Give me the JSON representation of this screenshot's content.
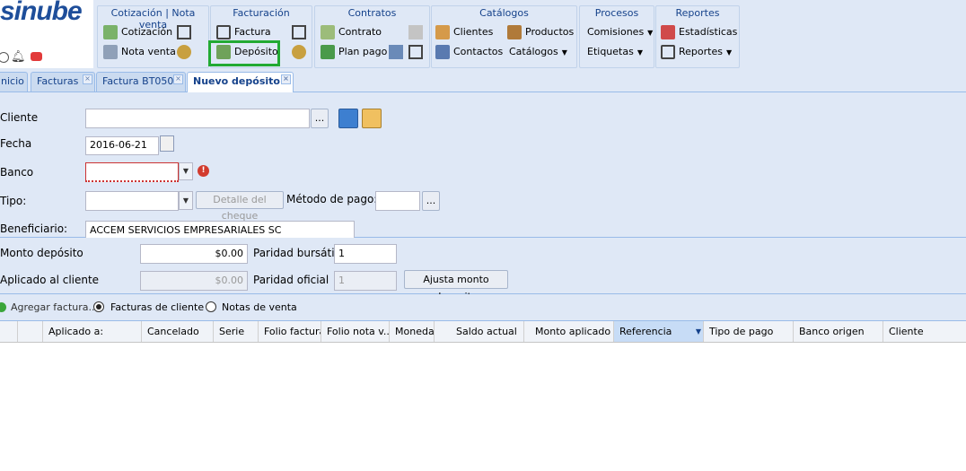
{
  "app": {
    "logo_text": "sinube"
  },
  "ribbon": {
    "groups": [
      {
        "title": "Cotización | Nota venta",
        "items": [
          "Cotización",
          "Nota venta"
        ]
      },
      {
        "title": "Facturación",
        "items": [
          "Factura",
          "Depósito"
        ]
      },
      {
        "title": "Contratos",
        "items": [
          "Contrato",
          "Plan pago"
        ]
      },
      {
        "title": "Catálogos",
        "items": [
          "Clientes",
          "Contactos",
          "Productos",
          "Catálogos"
        ]
      },
      {
        "title": "Procesos",
        "items": [
          "Comisiones",
          "Etiquetas"
        ]
      },
      {
        "title": "Reportes",
        "items": [
          "Estadísticas",
          "Reportes"
        ]
      }
    ],
    "highlight_color": "#22aa33"
  },
  "tabs": [
    {
      "label": "nicio"
    },
    {
      "label": "Facturas"
    },
    {
      "label": "Factura BT050"
    },
    {
      "label": "Nuevo depósito"
    }
  ],
  "form": {
    "cliente_label": "Cliente",
    "cliente_value": "",
    "fecha_label": "Fecha",
    "fecha_value": "2016-06-21",
    "banco_label": "Banco",
    "banco_value": "",
    "tipo_label": "Tipo:",
    "tipo_value": "",
    "detalle_button": "Detalle del cheque",
    "metodo_label": "Método de pago:",
    "metodo_value": "",
    "beneficiario_label": "Beneficiario:",
    "beneficiario_value": "ACCEM SERVICIOS EMPRESARIALES SC",
    "monto_label": "Monto depósito",
    "monto_value": "$0.00",
    "paridad_bursatil_label": "Paridad bursátil",
    "paridad_bursatil_value": "1",
    "aplicado_label": "Aplicado al cliente",
    "aplicado_value": "$0.00",
    "paridad_oficial_label": "Paridad oficial",
    "paridad_oficial_value": "1",
    "ajusta_button": "Ajusta monto deposito",
    "ellipsis": "..."
  },
  "toolbar": {
    "agregar_label": "Agregar factura...",
    "radio_facturas": "Facturas de cliente",
    "radio_notas": "Notas de venta"
  },
  "grid": {
    "columns": [
      "Aplicado a:",
      "Cancelado",
      "Serie",
      "Folio factura",
      "Folio nota v...",
      "Moneda",
      "Saldo actual",
      "Monto aplicado",
      "Referencia",
      "Tipo de pago",
      "Banco origen",
      "Cliente"
    ]
  }
}
